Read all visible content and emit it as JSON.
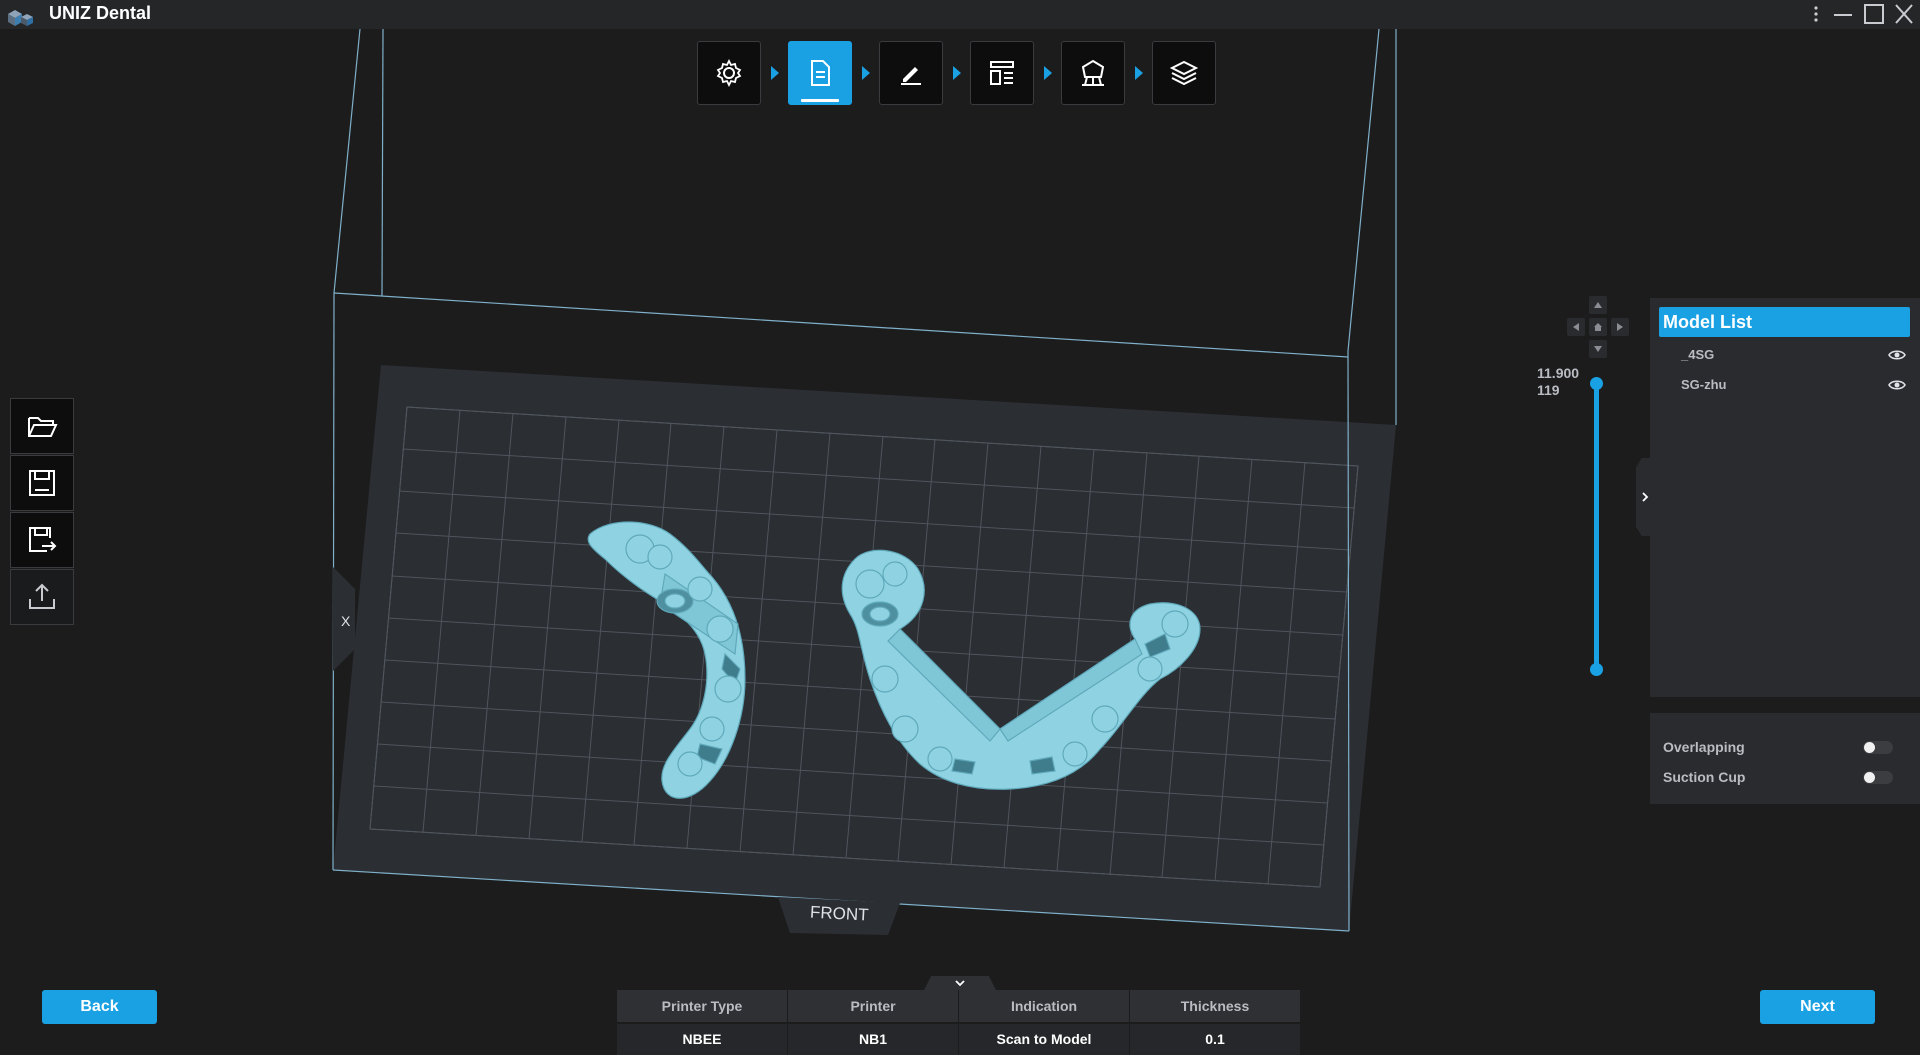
{
  "app": {
    "title": "UNIZ Dental",
    "window_controls": [
      "more-icon",
      "minimize-icon",
      "maximize-icon",
      "close-icon"
    ]
  },
  "workflow_steps": [
    {
      "icon": "gear-icon",
      "active": false
    },
    {
      "icon": "document-icon",
      "active": true
    },
    {
      "icon": "pen-icon",
      "active": false
    },
    {
      "icon": "layout-icon",
      "active": false
    },
    {
      "icon": "support-structure-icon",
      "active": false
    },
    {
      "icon": "layers-icon",
      "active": false
    }
  ],
  "left_toolbar": [
    {
      "icon": "folder-open-icon"
    },
    {
      "icon": "save-icon"
    },
    {
      "icon": "save-as-icon"
    },
    {
      "icon": "export-icon"
    }
  ],
  "viewport": {
    "axis_label": "X",
    "front_label": "FRONT",
    "accent_color": "#1aa1e3",
    "model_color": "#8fd3e3"
  },
  "height_slider": {
    "top_value": "11.900",
    "bottom_value": "119"
  },
  "model_list": {
    "title": "Model List",
    "items": [
      {
        "name": "_4SG",
        "visible": true
      },
      {
        "name": "SG-zhu",
        "visible": true
      }
    ]
  },
  "options": [
    {
      "label": "Overlapping",
      "enabled": false
    },
    {
      "label": "Suction Cup",
      "enabled": false
    }
  ],
  "buttons": {
    "back": "Back",
    "next": "Next"
  },
  "print_info": {
    "headers": [
      "Printer Type",
      "Printer",
      "Indication",
      "Thickness"
    ],
    "values": [
      "NBEE",
      "NB1",
      "Scan to Model",
      "0.1"
    ]
  }
}
